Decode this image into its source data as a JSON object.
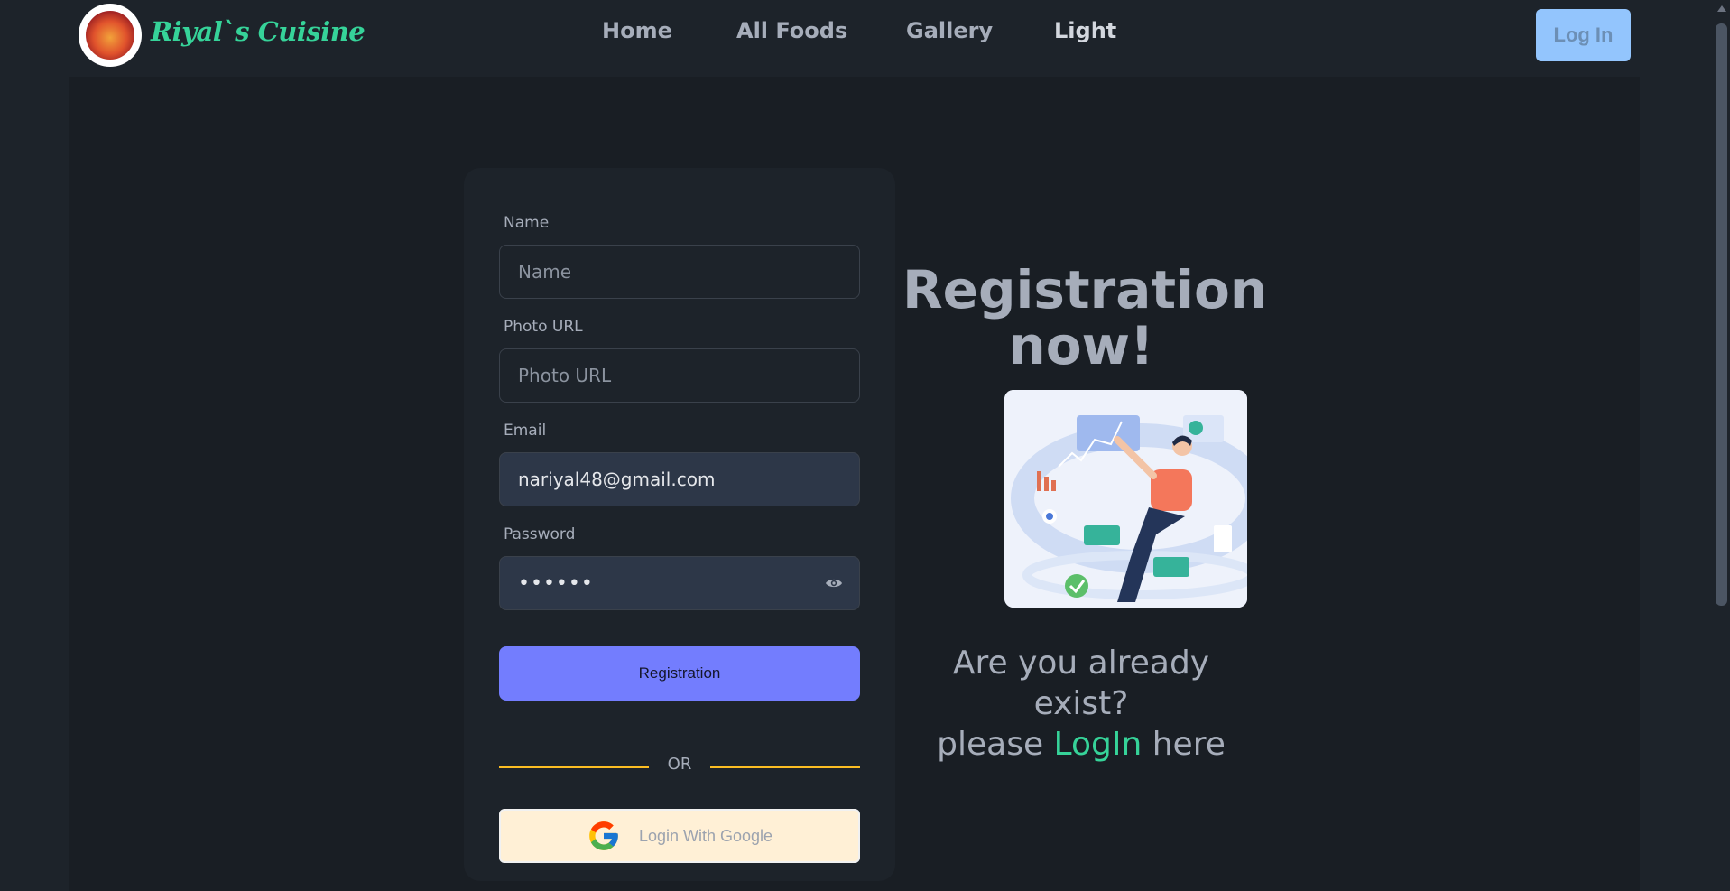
{
  "brand": {
    "name": "Riyal`s Cuisine",
    "logo_icon": "flame-cutlery-logo"
  },
  "nav": {
    "links": [
      {
        "label": "Home"
      },
      {
        "label": "All Foods"
      },
      {
        "label": "Gallery"
      },
      {
        "label": "Light"
      }
    ],
    "login_label": "Log In"
  },
  "form": {
    "name": {
      "label": "Name",
      "placeholder": "Name",
      "value": ""
    },
    "photo": {
      "label": "Photo URL",
      "placeholder": "Photo URL",
      "value": ""
    },
    "email": {
      "label": "Email",
      "value": "nariyal48@gmail.com"
    },
    "password": {
      "label": "Password",
      "masked_value": "••••••"
    },
    "submit_label": "Registration",
    "or_label": "OR",
    "google_label": "Login With Google"
  },
  "side": {
    "title_line1": "Registration",
    "title_line2": "now!",
    "prompt_line1": "Are you already",
    "prompt_line2": "exist?",
    "prompt_please": "please",
    "prompt_link": "LogIn",
    "prompt_here": "here"
  },
  "colors": {
    "accent_green": "#36d399",
    "primary": "#737dfe",
    "divider": "#fbbd23",
    "login_button": "#93c5fd"
  }
}
